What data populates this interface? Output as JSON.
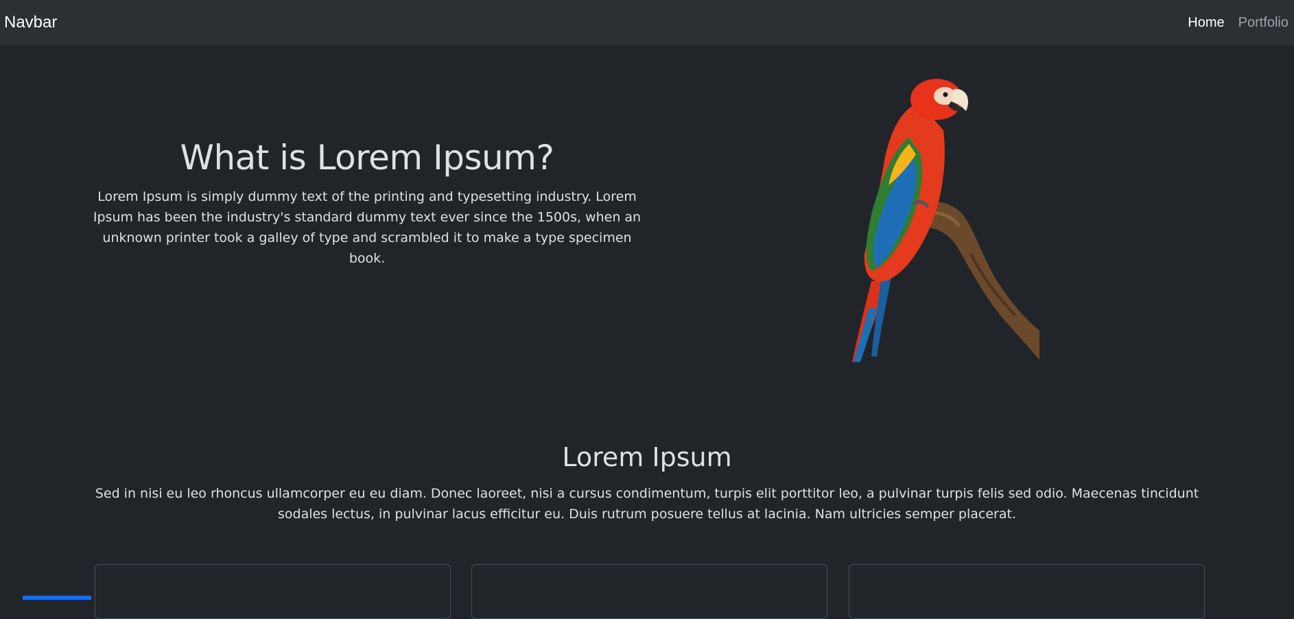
{
  "navbar": {
    "brand": "Navbar",
    "links": [
      {
        "label": "Home",
        "active": true
      },
      {
        "label": "Portfolio",
        "active": false
      }
    ]
  },
  "hero": {
    "title": "What is Lorem Ipsum?",
    "body": "Lorem Ipsum is simply dummy text of the printing and typesetting industry. Lorem Ipsum has been the industry's standard dummy text ever since the 1500s, when an unknown printer took a galley of type and scrambled it to make a type specimen book.",
    "image_subject": "parrot-on-branch"
  },
  "section": {
    "title": "Lorem Ipsum",
    "body": "Sed in nisi eu leo rhoncus ullamcorper eu eu diam. Donec laoreet, nisi a cursus condimentum, turpis elit porttitor leo, a pulvinar turpis felis sed odio. Maecenas tincidunt sodales lectus, in pulvinar lacus efficitur eu. Duis rutrum posuere tellus at lacinia. Nam ultricies semper placerat."
  },
  "colors": {
    "background": "#212529",
    "navbar": "#2b3035",
    "text": "#dee2e6",
    "accent": "#0d6efd"
  }
}
